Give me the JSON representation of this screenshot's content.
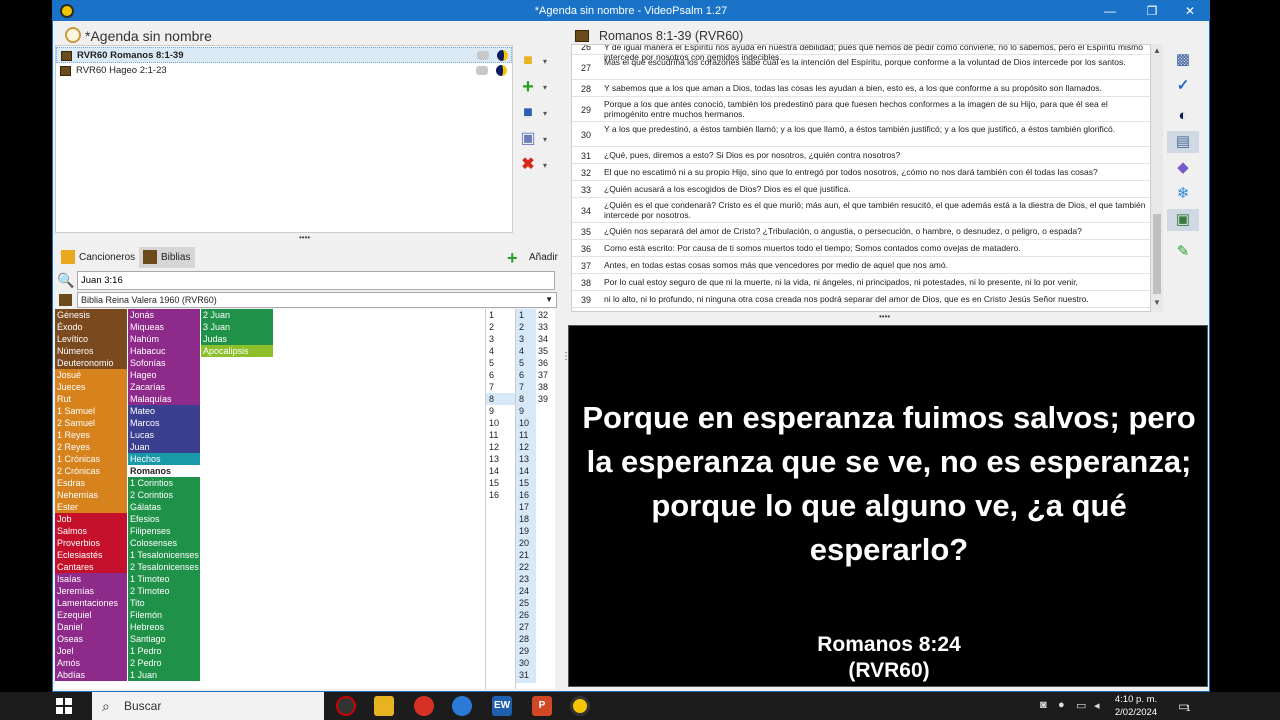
{
  "window": {
    "title": "*Agenda sin nombre - VideoPsalm 1.27",
    "minimize": "—",
    "restore": "❐",
    "close": "✕"
  },
  "agenda": {
    "title": "*Agenda sin nombre",
    "items": [
      {
        "label": "RVR60 Romanos 8:1-39"
      },
      {
        "label": "RVR60 Hageo 2:1-23"
      }
    ]
  },
  "tabs": {
    "songbooks": "Cancioneros",
    "bibles": "Biblias",
    "add": "Añadir"
  },
  "search": {
    "value": "Juan 3:16"
  },
  "bible_selector": {
    "value": "Biblia Reina Valera 1960 (RVR60)"
  },
  "books": {
    "col1": [
      {
        "name": "Génesis",
        "color": "#7a4a1e"
      },
      {
        "name": "Éxodo",
        "color": "#7a4a1e"
      },
      {
        "name": "Levítico",
        "color": "#7a4a1e"
      },
      {
        "name": "Números",
        "color": "#7a4a1e"
      },
      {
        "name": "Deuteronomio",
        "color": "#7a4a1e"
      },
      {
        "name": "Josué",
        "color": "#d6831e"
      },
      {
        "name": "Jueces",
        "color": "#d6831e"
      },
      {
        "name": "Rut",
        "color": "#d6831e"
      },
      {
        "name": "1 Samuel",
        "color": "#d6831e"
      },
      {
        "name": "2 Samuel",
        "color": "#d6831e"
      },
      {
        "name": "1 Reyes",
        "color": "#d6831e"
      },
      {
        "name": "2 Reyes",
        "color": "#d6831e"
      },
      {
        "name": "1 Crónicas",
        "color": "#d6831e"
      },
      {
        "name": "2 Crónicas",
        "color": "#d6831e"
      },
      {
        "name": "Esdras",
        "color": "#d6831e"
      },
      {
        "name": "Nehemías",
        "color": "#d6831e"
      },
      {
        "name": "Ester",
        "color": "#d6831e"
      },
      {
        "name": "Job",
        "color": "#c4102b"
      },
      {
        "name": "Salmos",
        "color": "#c4102b"
      },
      {
        "name": "Proverbios",
        "color": "#c4102b"
      },
      {
        "name": "Eclesiastés",
        "color": "#c4102b"
      },
      {
        "name": "Cantares",
        "color": "#c4102b"
      },
      {
        "name": "Isaías",
        "color": "#8e2a8a"
      },
      {
        "name": "Jeremías",
        "color": "#8e2a8a"
      },
      {
        "name": "Lamentaciones",
        "color": "#8e2a8a"
      },
      {
        "name": "Ezequiel",
        "color": "#8e2a8a"
      },
      {
        "name": "Daniel",
        "color": "#8e2a8a"
      },
      {
        "name": "Oseas",
        "color": "#8e2a8a"
      },
      {
        "name": "Joel",
        "color": "#8e2a8a"
      },
      {
        "name": "Amós",
        "color": "#8e2a8a"
      },
      {
        "name": "Abdías",
        "color": "#8e2a8a"
      }
    ],
    "col2": [
      {
        "name": "Jonás",
        "color": "#8e2a8a"
      },
      {
        "name": "Miqueas",
        "color": "#8e2a8a"
      },
      {
        "name": "Nahúm",
        "color": "#8e2a8a"
      },
      {
        "name": "Habacuc",
        "color": "#8e2a8a"
      },
      {
        "name": "Sofonías",
        "color": "#8e2a8a"
      },
      {
        "name": "Hageo",
        "color": "#8e2a8a"
      },
      {
        "name": "Zacarías",
        "color": "#8e2a8a"
      },
      {
        "name": "Malaquías",
        "color": "#8e2a8a"
      },
      {
        "name": "Mateo",
        "color": "#3b3f8f"
      },
      {
        "name": "Marcos",
        "color": "#3b3f8f"
      },
      {
        "name": "Lucas",
        "color": "#3b3f8f"
      },
      {
        "name": "Juan",
        "color": "#3b3f8f"
      },
      {
        "name": "Hechos",
        "color": "#1a9aa8"
      },
      {
        "name": "Romanos",
        "color": "#ffffff",
        "selected": true
      },
      {
        "name": "1 Corintios",
        "color": "#1f9148"
      },
      {
        "name": "2 Corintios",
        "color": "#1f9148"
      },
      {
        "name": "Gálatas",
        "color": "#1f9148"
      },
      {
        "name": "Efesios",
        "color": "#1f9148"
      },
      {
        "name": "Filipenses",
        "color": "#1f9148"
      },
      {
        "name": "Colosenses",
        "color": "#1f9148"
      },
      {
        "name": "1 Tesalonicenses",
        "color": "#1f9148"
      },
      {
        "name": "2 Tesalonicenses",
        "color": "#1f9148"
      },
      {
        "name": "1 Timoteo",
        "color": "#1f9148"
      },
      {
        "name": "2 Timoteo",
        "color": "#1f9148"
      },
      {
        "name": "Tito",
        "color": "#1f9148"
      },
      {
        "name": "Filemón",
        "color": "#1f9148"
      },
      {
        "name": "Hebreos",
        "color": "#1f9148"
      },
      {
        "name": "Santiago",
        "color": "#1f9148"
      },
      {
        "name": "1 Pedro",
        "color": "#1f9148"
      },
      {
        "name": "2 Pedro",
        "color": "#1f9148"
      },
      {
        "name": "1 Juan",
        "color": "#1f9148"
      }
    ],
    "col3": [
      {
        "name": "2 Juan",
        "color": "#1f9148"
      },
      {
        "name": "3 Juan",
        "color": "#1f9148"
      },
      {
        "name": "Judas",
        "color": "#1f9148"
      },
      {
        "name": "Apocalipsis",
        "color": "#8cbf2a"
      }
    ]
  },
  "chapters": [
    "1",
    "2",
    "3",
    "4",
    "5",
    "6",
    "7",
    "8",
    "9",
    "10",
    "11",
    "12",
    "13",
    "14",
    "15",
    "16"
  ],
  "selected_chapter": "8",
  "verses_a": [
    "1",
    "2",
    "3",
    "4",
    "5",
    "6",
    "7",
    "8",
    "9",
    "10",
    "11",
    "12",
    "13",
    "14",
    "15",
    "16",
    "17",
    "18",
    "19",
    "20",
    "21",
    "22",
    "23",
    "24",
    "25",
    "26",
    "27",
    "28",
    "29",
    "30",
    "31"
  ],
  "verses_b": [
    "32",
    "33",
    "34",
    "35",
    "36",
    "37",
    "38",
    "39"
  ],
  "passage": {
    "title": "Romanos 8:1-39 (RVR60)",
    "verses": [
      {
        "n": "26",
        "text": "Y de igual manera el Espíritu nos ayuda en nuestra debilidad; pues qué hemos de pedir como conviene, no lo sabemos, pero el Espíritu mismo intercede por nosotros con gemidos indecibles."
      },
      {
        "n": "27",
        "text": "Mas el que escudriña los corazones sabe cuál es la intención del Espíritu, porque conforme a la voluntad de Dios intercede por los santos."
      },
      {
        "n": "28",
        "text": "Y sabemos que a los que aman a Dios, todas las cosas les ayudan a bien, esto es, a los que conforme a su propósito son llamados."
      },
      {
        "n": "29",
        "text": "Porque a los que antes conoció, también los predestinó para que fuesen hechos conformes a la imagen de su Hijo, para que él sea el primogénito entre muchos hermanos."
      },
      {
        "n": "30",
        "text": "Y a los que predestinó, a éstos también llamó; y a los que llamó, a éstos también justificó; y a los que justificó, a éstos también glorificó."
      },
      {
        "n": "31",
        "text": "¿Qué, pues, diremos a esto? Si Dios es por nosotros, ¿quién contra nosotros?"
      },
      {
        "n": "32",
        "text": "El que no escatimó ni a su propio Hijo, sino que lo entregó por todos nosotros, ¿cómo no nos dará también con él todas las cosas?"
      },
      {
        "n": "33",
        "text": "¿Quién acusará a los escogidos de Dios? Dios es el que justifica."
      },
      {
        "n": "34",
        "text": "¿Quién es el que condenará? Cristo es el que murió; más aun, el que también resucitó, el que además está a la diestra de Dios, el que también intercede por nosotros."
      },
      {
        "n": "35",
        "text": "¿Quién nos separará del amor de Cristo? ¿Tribulación, o angustia, o persecución, o hambre, o desnudez, o peligro, o espada?"
      },
      {
        "n": "36",
        "text": "Como está escrito: Por causa de ti somos muertos todo el tiempo; Somos contados como ovejas de matadero."
      },
      {
        "n": "37",
        "text": "Antes, en todas estas cosas somos más que vencedores por medio de aquel que nos amó."
      },
      {
        "n": "38",
        "text": "Por lo cual estoy seguro de que ni la muerte, ni la vida, ni ángeles, ni principados, ni potestades, ni lo presente, ni lo por venir,"
      },
      {
        "n": "39",
        "text": "ni lo alto, ni lo profundo, ni ninguna otra cosa creada nos podrá separar del amor de Dios, que es en Cristo Jesús Señor nuestro."
      }
    ]
  },
  "preview": {
    "text": "Porque en esperanza fuimos salvos; pero la esperanza que se ve, no es esperanza; porque lo que alguno ve, ¿a qué esperarlo?",
    "reference": "Romanos 8:24",
    "version": "(RVR60)"
  },
  "taskbar": {
    "search_placeholder": "Buscar",
    "time": "4:10 p. m.",
    "date": "2/02/2024",
    "notification_count": "1"
  }
}
